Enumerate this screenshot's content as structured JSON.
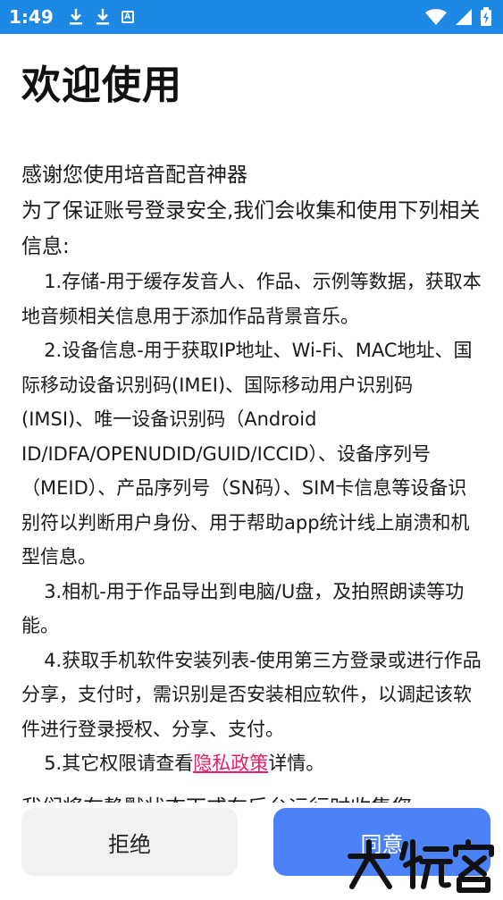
{
  "status_bar": {
    "time": "1:49",
    "app_badge": "A",
    "icons": [
      "download-icon",
      "download-icon",
      "app-notification-icon",
      "wifi-icon",
      "signal-icon",
      "battery-icon"
    ]
  },
  "dialog": {
    "title": "欢迎使用",
    "intro": [
      "感谢您使用培音配音神器",
      "为了保证账号登录安全,我们会收集和使用下列相关信息:"
    ],
    "items": [
      "1.存储-用于缓存发音人、作品、示例等数据，获取本地音频相关信息用于添加作品背景音乐。",
      "2.设备信息-用于获取IP地址、Wi-Fi、MAC地址、国际移动设备识别码(IMEI)、国际移动用户识别码(IMSI)、唯一设备识别码（Android ID/IDFA/OPENUDID/GUID/ICCID）、设备序列号（MEID）、产品序列号（SN码）、SIM卡信息等设备识别符以判断用户身份、用于帮助app统计线上崩溃和机型信息。",
      "3.相机-用于作品导出到电脑/U盘，及拍照朗读等功能。",
      "4.获取手机软件安装列表-使用第三方登录或进行作品分享，支付时，需识别是否安装相应软件，以调起该软件进行登录授权、分享、支付。"
    ],
    "item5_prefix": "5.其它权限请查看",
    "item5_link": "隐私政策",
    "item5_suffix": "详情。",
    "cut_text": "我们将在静默状态下或在后台运行时收集您",
    "reject_label": "拒绝",
    "agree_label": "同意"
  },
  "colors": {
    "status_bar": "#1e88e5",
    "agree_button": "#4c82f7",
    "reject_button": "#f1f1f1",
    "link": "#e91e63"
  }
}
